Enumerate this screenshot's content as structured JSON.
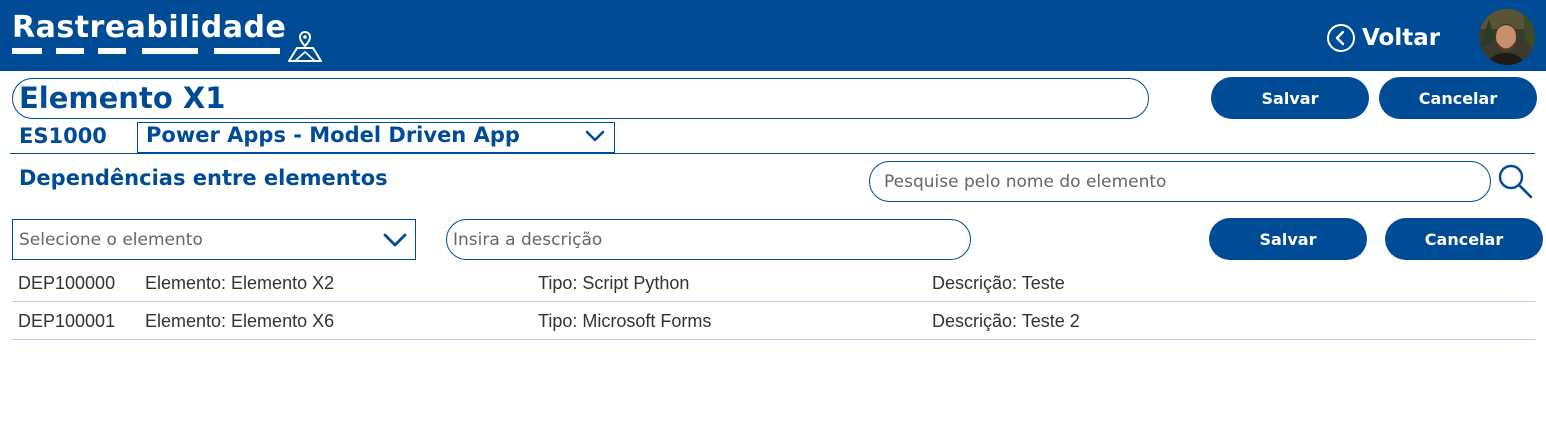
{
  "header": {
    "app_title": "Rastreabilidade",
    "back_label": "Voltar",
    "icons": {
      "trace": "map-pin-route-icon",
      "back": "chevron-left-circle-icon",
      "avatar": "user-avatar"
    }
  },
  "element": {
    "name": "Elemento X1",
    "code": "ES1000",
    "type_selected": "Power Apps - Model Driven App"
  },
  "top_actions": {
    "save_label": "Salvar",
    "cancel_label": "Cancelar"
  },
  "dependencies": {
    "title": "Dependências entre elementos",
    "search_placeholder": "Pesquise pelo nome do elemento",
    "element_select_placeholder": "Selecione o elemento",
    "description_placeholder": "Insira a descrição",
    "save_label": "Salvar",
    "cancel_label": "Cancelar",
    "rows": [
      {
        "id": "DEP100000",
        "element": "Elemento: Elemento X2",
        "type": "Tipo: Script Python",
        "description": "Descrição: Teste"
      },
      {
        "id": "DEP100001",
        "element": "Elemento: Elemento X6",
        "type": "Tipo: Microsoft Forms",
        "description": "Descrição: Teste 2"
      }
    ]
  },
  "colors": {
    "brand": "#004B96",
    "row_divider": "#b8d0e6",
    "background": "#ffffff"
  }
}
